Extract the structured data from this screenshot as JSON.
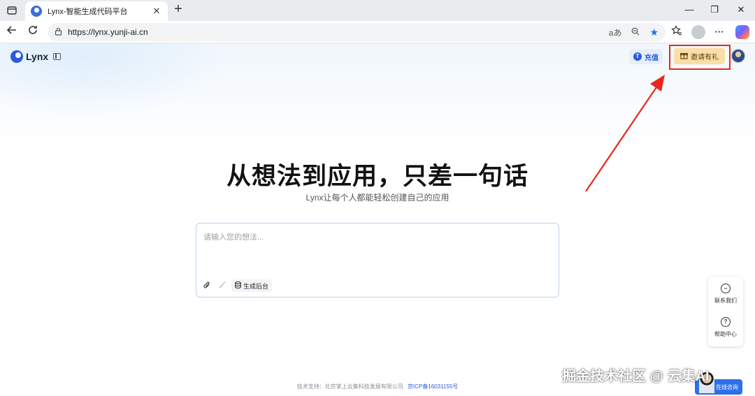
{
  "browser": {
    "tab_title": "Lynx-智能生成代码平台",
    "tab_close": "✕",
    "new_tab": "+",
    "url": "https://lynx.yunji-ai.cn",
    "omnibox_icons": [
      "read-aloud-icon",
      "zoom-icon",
      "favorite-star-icon"
    ],
    "read_aloud_glyph": "aあ",
    "window_controls": {
      "minimize": "—",
      "restore": "❐",
      "close": "✕"
    }
  },
  "header": {
    "logo_text": "Lynx",
    "recharge_label": "充值",
    "recharge_icon": "T",
    "invite_label": "邀请有礼"
  },
  "hero": {
    "headline": "从想法到应用，只差一句话",
    "subheadline": "Lynx让每个人都能轻松创建自己的应用"
  },
  "composer": {
    "placeholder": "请输入您的想法...",
    "backend_label": "生成后台"
  },
  "float_panel": {
    "contact_label": "联系我们",
    "help_label": "帮助中心"
  },
  "footer": {
    "support_text": "技术支持：北京掌上云集科技发展有限公司",
    "icp_text": "京ICP备16031155号"
  },
  "overlay": {
    "watermark": "掘金技术社区 @ 云集AI",
    "consult_label": "在线咨询"
  },
  "colors": {
    "accent": "#2c5bd9",
    "annotation_red": "#e8281e",
    "invite_bg": "#f9dfa6"
  }
}
